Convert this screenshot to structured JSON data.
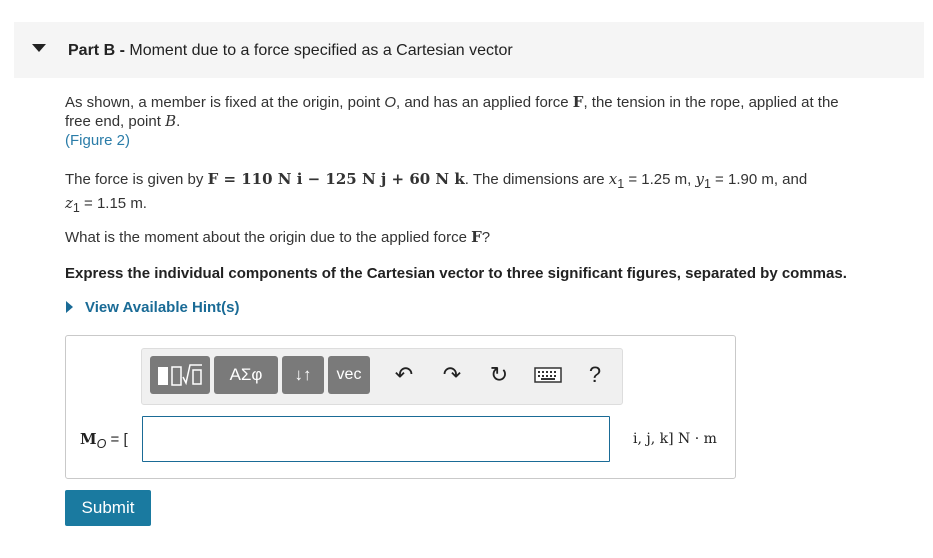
{
  "header": {
    "part": "Part B -",
    "title": "Moment due to a force specified as a Cartesian vector"
  },
  "intro": {
    "line1": "As shown, a member is fixed at the origin, point",
    "o": "O",
    "line1b": ", and has an applied force",
    "F": "F",
    "line1c": ", the tension in the rope, applied at the",
    "line2": "free end, point",
    "B": "B",
    "line2b": ".",
    "figure_link": "(Figure 2)"
  },
  "force": {
    "prefix": "The force is given by",
    "equation": "F = 110 N i − 125 N j + 60 N k",
    "dims_prefix": ". The dimensions are",
    "x1": "x",
    "x1_value": " = 1.25 m,",
    "y1": "y",
    "y1_value": " = 1.90 m, and",
    "z1": "z",
    "z1_value": " = 1.15 m."
  },
  "question": {
    "text": "What is the moment about the origin due to the applied force",
    "F": "F",
    "end": "?"
  },
  "instruction": "Express the individual components of the Cartesian vector to three significant figures, separated by commas.",
  "hint_label": "View Available Hint(s)",
  "toolbar": {
    "sym_label": "ΑΣφ",
    "updown_label": "↓↑",
    "vec_label": "vec",
    "help_label": "?"
  },
  "answer": {
    "label": "M",
    "sub": "O",
    "eq": " = [",
    "value": "",
    "units": "i, j, k] N · m"
  },
  "submit_label": "Submit"
}
